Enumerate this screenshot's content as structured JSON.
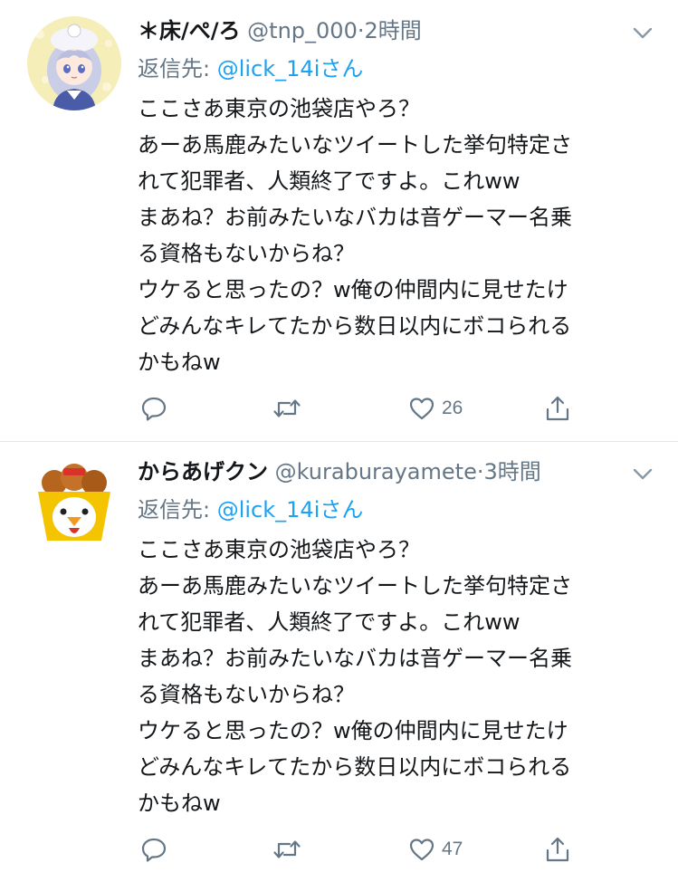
{
  "tweets": [
    {
      "display_name": "＊床/ぺ/ろ",
      "handle": "@tnp_000",
      "separator_dot": "·",
      "time": "2時間",
      "reply_prefix": "返信先: ",
      "reply_target": "@lick_14iさん",
      "lines": [
        "ここさあ東京の池袋店やろ？",
        "あーあ馬鹿みたいなツイートした挙句特定さ",
        "れて犯罪者、人類終了ですよ。これww",
        "まあね？お前みたいなバカは音ゲーマー名乗",
        "る資格もないからね？",
        "ウケると思ったの？w俺の仲間内に見せたけ",
        "どみんなキレてたから数日以内にボコられる",
        "かもねw"
      ],
      "likes": "26",
      "avatar_icon": "anime-character-avatar"
    },
    {
      "display_name": "からあげクン",
      "handle": "@kuraburayamete",
      "separator_dot": "·",
      "time": "3時間",
      "reply_prefix": "返信先: ",
      "reply_target": "@lick_14iさん",
      "lines": [
        "ここさあ東京の池袋店やろ？",
        "あーあ馬鹿みたいなツイートした挙句特定さ",
        "れて犯罪者、人類終了ですよ。これww",
        "まあね？お前みたいなバカは音ゲーマー名乗",
        "る資格もないからね？",
        "ウケると思ったの？w俺の仲間内に見せたけ",
        "どみんなキレてたから数日以内にボコられる",
        "かもねw"
      ],
      "likes": "47",
      "avatar_icon": "karaage-kun-chicken-avatar"
    }
  ],
  "icons": {
    "reply": "reply-icon",
    "retweet": "retweet-icon",
    "like": "heart-icon",
    "share": "share-icon",
    "menu": "chevron-down-icon"
  },
  "colors": {
    "text": "#14171a",
    "secondary": "#657786",
    "link": "#1da1f2",
    "divider": "#e1e8ed"
  }
}
